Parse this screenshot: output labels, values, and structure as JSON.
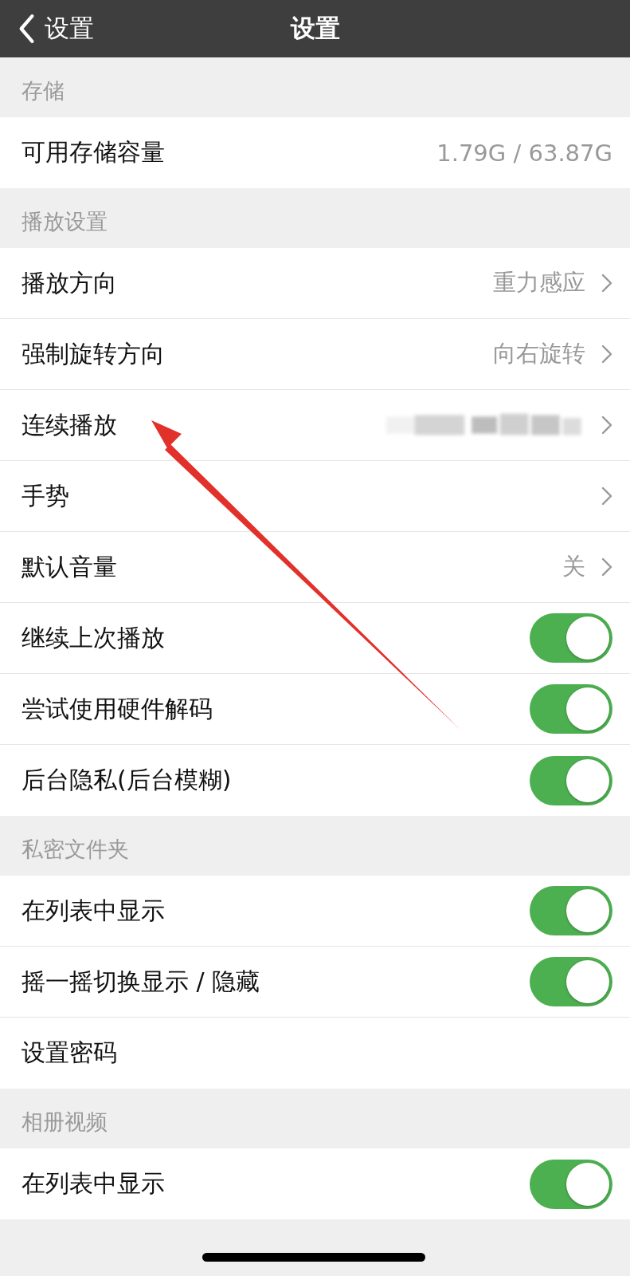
{
  "nav_bar": {
    "back_label": "设置",
    "title": "设置"
  },
  "sections": [
    {
      "title": "存储",
      "rows": [
        {
          "kind": "value",
          "label": "可用存储容量",
          "value": "1.79G / 63.87G"
        }
      ]
    },
    {
      "title": "播放设置",
      "rows": [
        {
          "kind": "link",
          "label": "播放方向",
          "value": "重力感应"
        },
        {
          "kind": "link",
          "label": "强制旋转方向",
          "value": "向右旋转"
        },
        {
          "kind": "redacted_link",
          "label": "连续播放"
        },
        {
          "kind": "link",
          "label": "手势"
        },
        {
          "kind": "link",
          "label": "默认音量",
          "value": "关"
        },
        {
          "kind": "toggle",
          "label": "继续上次播放",
          "on": true
        },
        {
          "kind": "toggle",
          "label": "尝试使用硬件解码",
          "on": true
        },
        {
          "kind": "toggle",
          "label": "后台隐私(后台模糊)",
          "on": true
        }
      ]
    },
    {
      "title": "私密文件夹",
      "rows": [
        {
          "kind": "toggle",
          "label": "在列表中显示",
          "on": true
        },
        {
          "kind": "toggle",
          "label": "摇一摇切换显示 / 隐藏",
          "on": true
        },
        {
          "kind": "plain",
          "label": "设置密码"
        }
      ]
    },
    {
      "title": "相册视频",
      "rows": [
        {
          "kind": "toggle",
          "label": "在列表中显示",
          "on": true
        }
      ]
    }
  ]
}
